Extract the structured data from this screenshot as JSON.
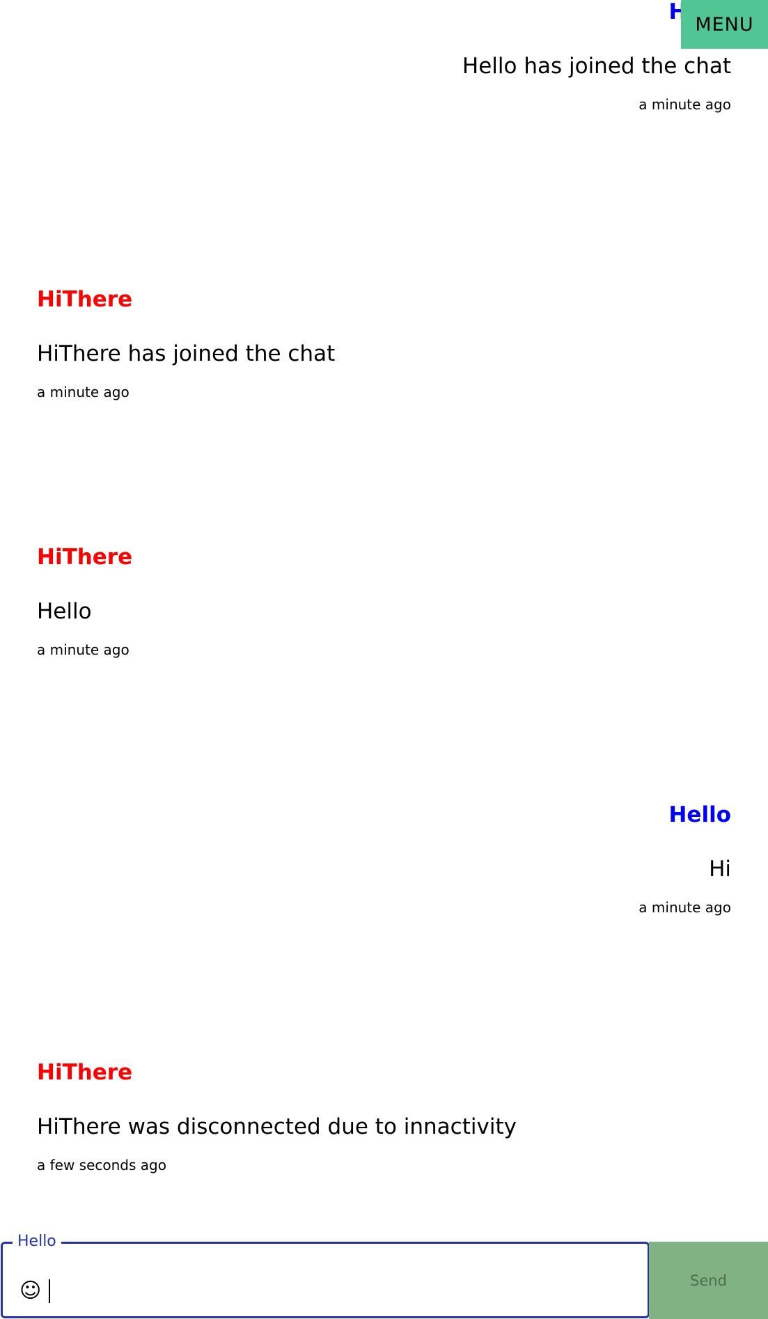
{
  "menu": {
    "label": "MENU"
  },
  "messages": [
    {
      "sender": "Hello",
      "text": "Hello has joined the chat",
      "time": "a minute ago",
      "side": "mine"
    },
    {
      "sender": "HiThere",
      "text": "HiThere has joined the chat",
      "time": "a minute ago",
      "side": "theirs"
    },
    {
      "sender": "HiThere",
      "text": "Hello",
      "time": "a minute ago",
      "side": "theirs"
    },
    {
      "sender": "Hello",
      "text": "Hi",
      "time": "a minute ago",
      "side": "mine"
    },
    {
      "sender": "HiThere",
      "text": "HiThere was disconnected due to innactivity",
      "time": "a few seconds ago",
      "side": "theirs"
    }
  ],
  "composer": {
    "label": "Hello",
    "value": "",
    "emoji_icon": "smiley-face-icon",
    "send_label": "Send"
  },
  "colors": {
    "own_sender": "#0000ff",
    "other_sender": "#ff0000",
    "menu_bg": "#52c595",
    "send_bg": "#80b283",
    "field_border": "#2734a8"
  }
}
